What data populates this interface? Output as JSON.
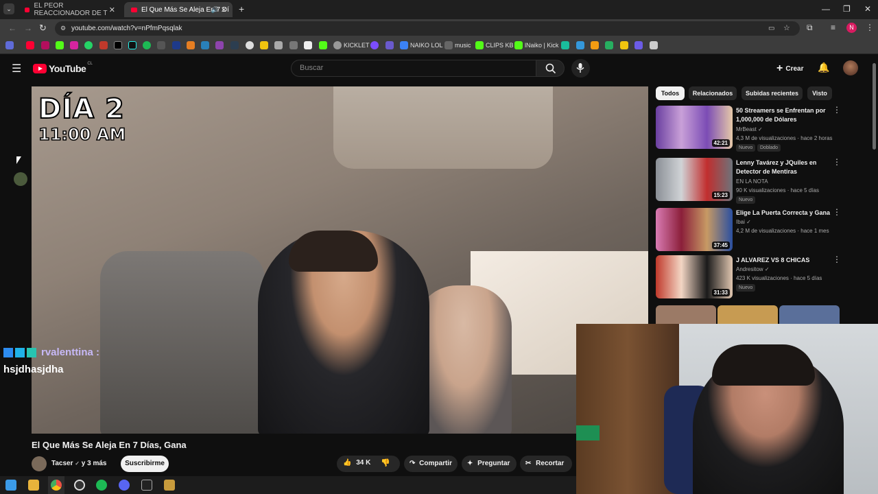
{
  "browser": {
    "tabs": [
      {
        "title": "EL PEOR REACCIONADOR DE T"
      },
      {
        "title": "El Que Más Se Aleja En 7 Dí"
      }
    ],
    "url": "youtube.com/watch?v=nPfmPqsqlak",
    "profile_initial": "N",
    "bookmarks": [
      "KICKLET",
      "NAIKO LOL",
      "music",
      "CLIPS KB",
      "lNaiko | Kick"
    ]
  },
  "youtube": {
    "logo_text": "YouTube",
    "region": "CL",
    "search_placeholder": "Buscar",
    "create_label": "Crear"
  },
  "video": {
    "overlay_day": "DÍA 2",
    "overlay_time": "11:00 AM",
    "title": "El Que Más Se Aleja En 7 Días, Gana",
    "channel": "Tacser",
    "collab": "y 3 más",
    "subscribe_label": "Suscribirme",
    "likes": "34 K",
    "share_label": "Compartir",
    "ask_label": "Preguntar",
    "clip_label": "Recortar"
  },
  "chips": [
    "Todos",
    "Relacionados",
    "Subidas recientes",
    "Visto"
  ],
  "recommendations": [
    {
      "title": "50 Streamers se Enfrentan por 1,000,000 de Dólares",
      "channel": "MrBeast",
      "stats": "4,3 M de visualizaciones · hace 2 horas",
      "duration": "42:21",
      "badges": [
        "Nuevo",
        "Doblado"
      ]
    },
    {
      "title": "Lenny Tavárez y JQuiles en Detector de Mentiras",
      "channel": "EN LA NOTA",
      "stats": "90 K visualizaciones · hace 5 días",
      "duration": "15:23",
      "badges": [
        "Nuevo"
      ]
    },
    {
      "title": "Elige La Puerta Correcta y Gana",
      "channel": "Ibai",
      "stats": "4,2 M de visualizaciones · hace 1 mes",
      "duration": "37:45",
      "badges": []
    },
    {
      "title": "J ALVAREZ VS 8 CHICAS",
      "channel": "Andresitow",
      "stats": "423 K visualizaciones · hace 5 días",
      "duration": "31:33",
      "badges": [
        "Nuevo"
      ]
    }
  ],
  "chat": {
    "user": "rvalenttina :",
    "message": "hsjdhasjdha"
  },
  "colors": {
    "youtube_red": "#ff0033",
    "background": "#0f0f0f",
    "chip_bg": "#272727"
  }
}
